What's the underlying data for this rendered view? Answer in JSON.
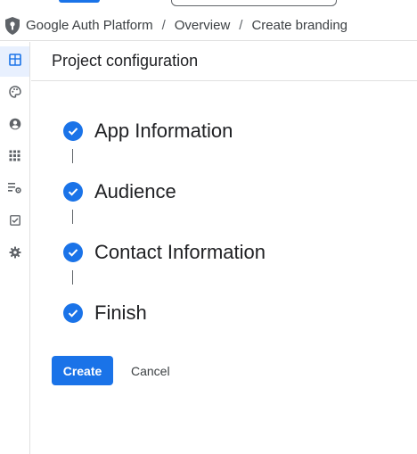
{
  "breadcrumb": {
    "items": [
      "Google Auth Platform",
      "Overview",
      "Create branding"
    ],
    "separator": "/"
  },
  "rail": {
    "items": [
      {
        "icon": "dashboard-icon",
        "active": true
      },
      {
        "icon": "palette-icon",
        "active": false
      },
      {
        "icon": "account-circle-icon",
        "active": false
      },
      {
        "icon": "apps-grid-icon",
        "active": false
      },
      {
        "icon": "list-settings-icon",
        "active": false
      },
      {
        "icon": "checkbox-icon",
        "active": false
      },
      {
        "icon": "gear-icon",
        "active": false
      }
    ]
  },
  "page": {
    "title": "Project configuration"
  },
  "steps": [
    {
      "label": "App Information",
      "status": "complete"
    },
    {
      "label": "Audience",
      "status": "complete"
    },
    {
      "label": "Contact Information",
      "status": "complete"
    },
    {
      "label": "Finish",
      "status": "complete"
    }
  ],
  "actions": {
    "create_label": "Create",
    "cancel_label": "Cancel"
  },
  "colors": {
    "accent": "#1a73e8",
    "rail_active_bg": "#e8f0fe",
    "text": "#202124",
    "icon": "#5f6368"
  }
}
